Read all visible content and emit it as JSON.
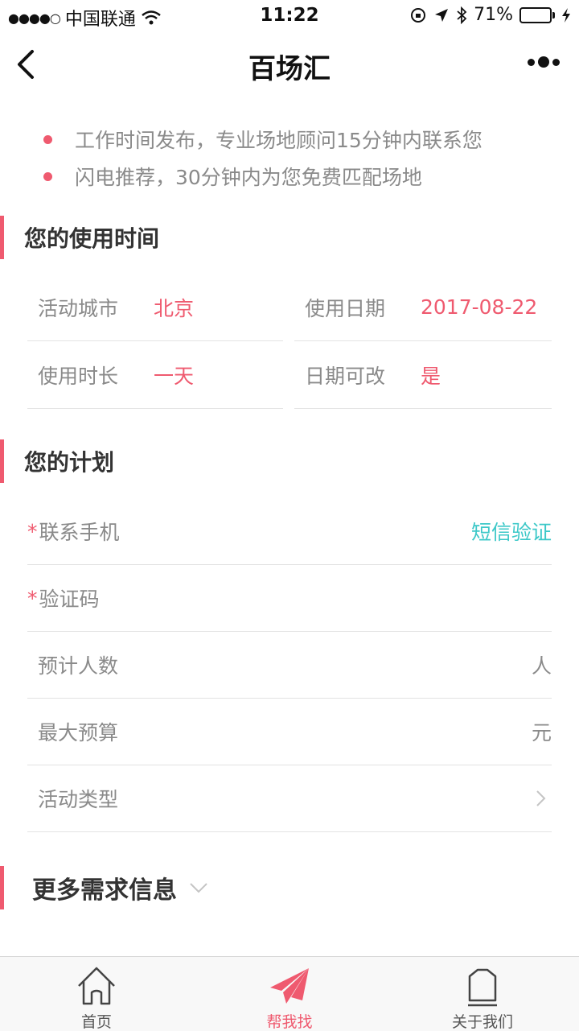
{
  "status_bar": {
    "signal": "●●●●○",
    "carrier": "中国联通",
    "time": "11:22",
    "battery": "71%",
    "battery_level": 0.71
  },
  "nav": {
    "title": "百场汇"
  },
  "bullets": [
    "工作时间发布，专业场地顾问15分钟内联系您",
    "闪电推荐，30分钟内为您免费匹配场地"
  ],
  "usage_section": {
    "title": "您的使用时间",
    "fields": [
      {
        "label": "活动城市",
        "value": "北京"
      },
      {
        "label": "使用日期",
        "value": "2017-08-22"
      },
      {
        "label": "使用时长",
        "value": "一天"
      },
      {
        "label": "日期可改",
        "value": "是"
      }
    ]
  },
  "plan_section": {
    "title": "您的计划",
    "required_mark": "*",
    "phone_label": "联系手机",
    "sms_button": "短信验证",
    "code_label": "验证码",
    "people_label": "预计人数",
    "people_unit": "人",
    "budget_label": "最大预算",
    "budget_unit": "元",
    "type_label": "活动类型"
  },
  "more_section": {
    "title": "更多需求信息"
  },
  "tabs": [
    {
      "label": "首页",
      "icon": "home-icon"
    },
    {
      "label": "帮我找",
      "icon": "paper-plane-icon"
    },
    {
      "label": "关于我们",
      "icon": "about-icon"
    }
  ],
  "colors": {
    "accent": "#ef5a6f",
    "sms": "#3cc8c8",
    "muted": "#8a8a8a"
  }
}
